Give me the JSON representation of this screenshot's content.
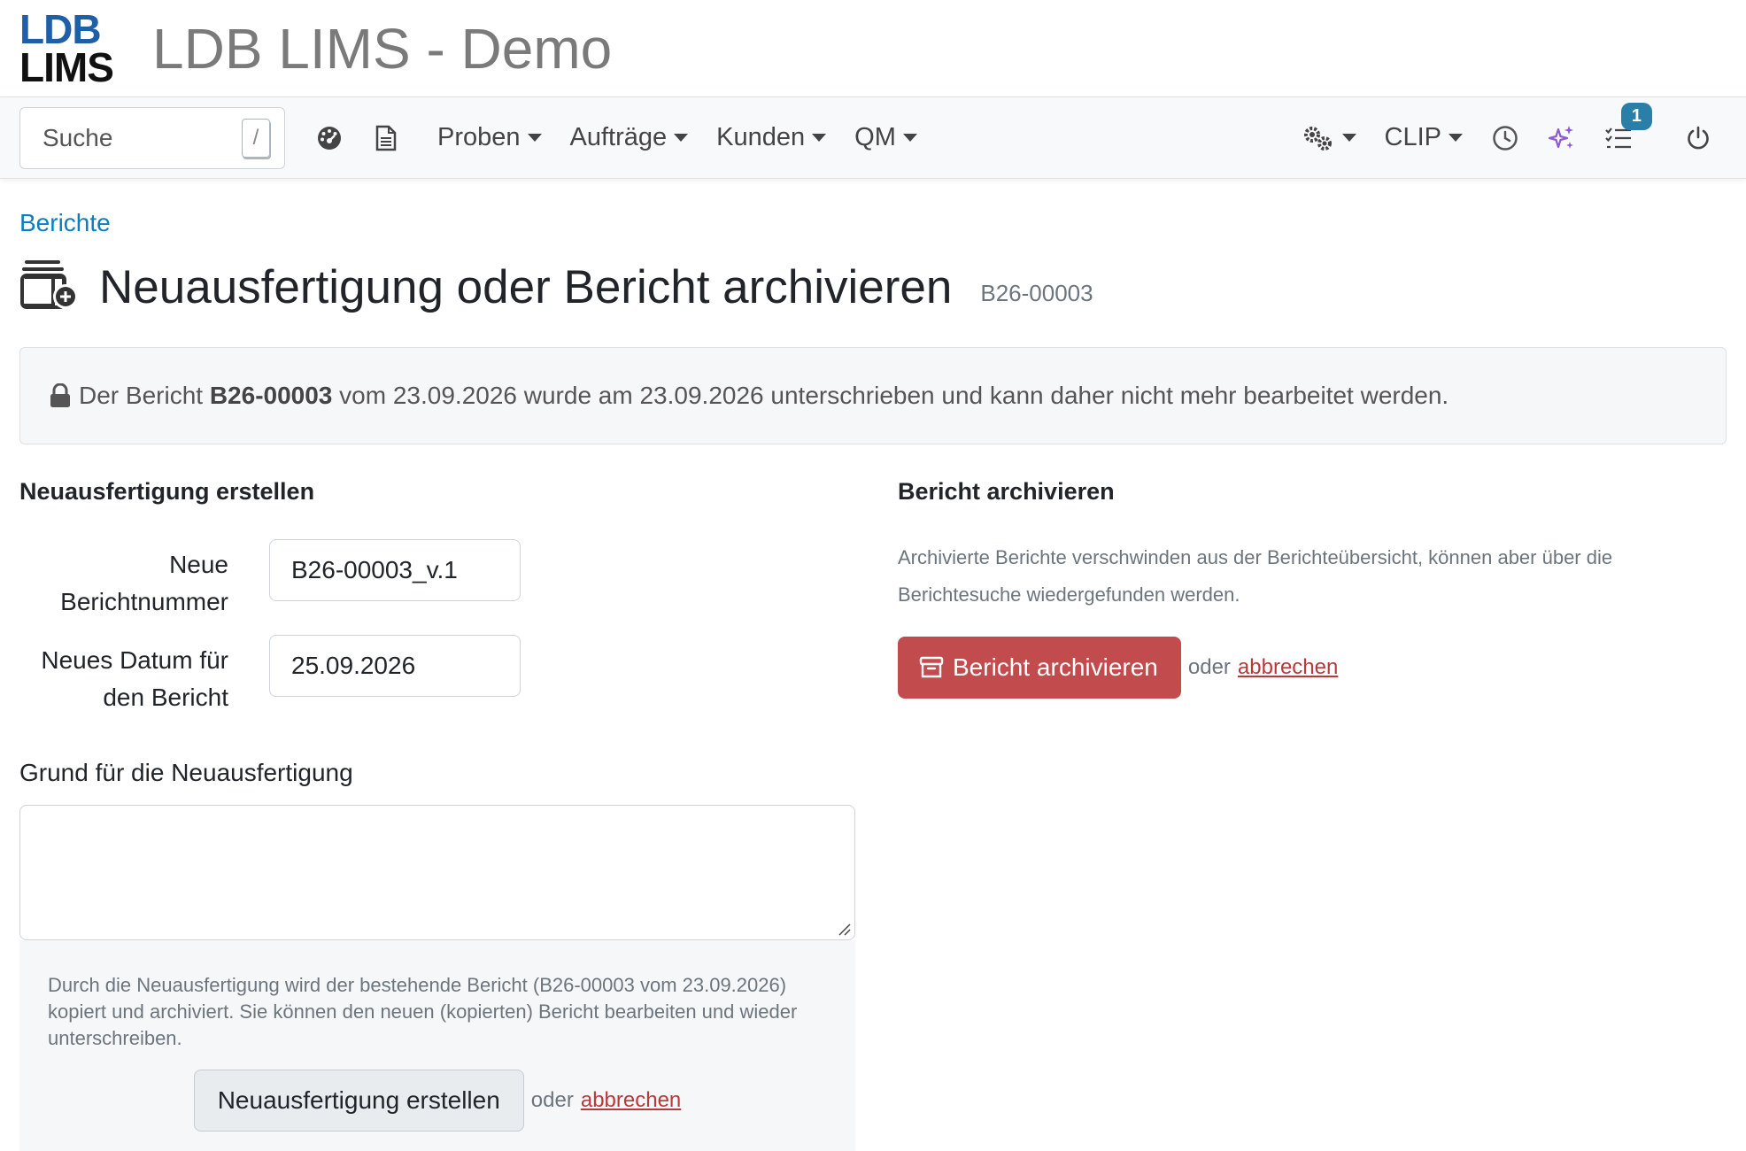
{
  "app": {
    "logo_line1": "LDB",
    "logo_line2": "LIMS",
    "title": "LDB LIMS - Demo"
  },
  "navbar": {
    "search_placeholder": "Suche",
    "search_shortcut": "/",
    "menu": [
      "Proben",
      "Aufträge",
      "Kunden",
      "QM"
    ],
    "clip_label": "CLIP",
    "tasks_badge": "1"
  },
  "breadcrumb": "Berichte",
  "page": {
    "title": "Neuausfertigung oder Bericht archivieren",
    "report_id": "B26-00003"
  },
  "alert": {
    "prefix": "Der Bericht",
    "report": "B26-00003",
    "suffix": "vom 23.09.2026 wurde am 23.09.2026 unterschrieben und kann daher nicht mehr bearbeitet werden."
  },
  "left": {
    "heading": "Neuausfertigung erstellen",
    "new_number_label": "Neue Berichtnummer",
    "new_number_value": "B26-00003_v.1",
    "new_date_label": "Neues Datum für den Bericht",
    "new_date_value": "25.09.2026",
    "reason_label": "Grund für die Neuausfertigung",
    "reason_value": "",
    "info": "Durch die Neuausfertigung wird der bestehende Bericht (B26-00003 vom 23.09.2026) kopiert und archiviert. Sie können den neuen (kopierten) Bericht bearbeiten und wieder unterschreiben.",
    "submit_label": "Neuausfertigung erstellen",
    "or_label": "oder",
    "cancel_label": "abbrechen"
  },
  "right": {
    "heading": "Bericht archivieren",
    "description": "Archivierte Berichte verschwinden aus der Berichteübersicht, können aber über die Berichtesuche wiedergefunden werden.",
    "archive_label": "Bericht archivieren",
    "or_label": "oder",
    "cancel_label": "abbrechen"
  },
  "colors": {
    "accent": "#2a7fa8",
    "danger": "#c24b4d",
    "link": "#0a7fc0",
    "logo_blue": "#1f5fa8",
    "sparkle": "#8e5bd0"
  }
}
